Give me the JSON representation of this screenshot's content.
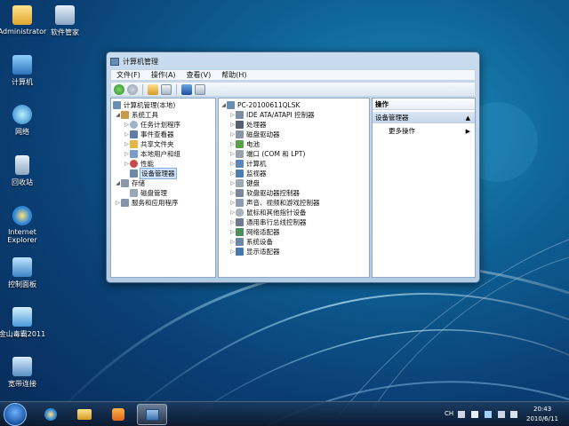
{
  "desktop": {
    "icons": [
      {
        "label": "Administrator",
        "icon": "user-folder-icon"
      },
      {
        "label": "软件管家",
        "icon": "software-manager-icon"
      },
      {
        "label": "计算机",
        "icon": "computer-icon"
      },
      {
        "label": "网络",
        "icon": "network-icon"
      },
      {
        "label": "回收站",
        "icon": "recycle-bin-icon"
      },
      {
        "label": "Internet Explorer",
        "icon": "internet-explorer-icon"
      },
      {
        "label": "控制面板",
        "icon": "control-panel-icon"
      },
      {
        "label": "金山毒霸2011",
        "icon": "antivirus-icon"
      },
      {
        "label": "宽带连接",
        "icon": "broadband-icon"
      }
    ]
  },
  "window": {
    "title": "计算机管理",
    "menu": [
      "文件(F)",
      "操作(A)",
      "查看(V)",
      "帮助(H)"
    ],
    "toolbar": [
      "back-icon",
      "forward-icon",
      "up-icon",
      "show-tree-icon",
      "help-icon",
      "properties-icon"
    ],
    "left_tree": [
      {
        "label": "计算机管理(本地)",
        "level": 0,
        "arrow": ""
      },
      {
        "label": "系统工具",
        "level": 1,
        "arrow": "◢"
      },
      {
        "label": "任务计划程序",
        "level": 2,
        "arrow": "▷"
      },
      {
        "label": "事件查看器",
        "level": 2,
        "arrow": "▷"
      },
      {
        "label": "共享文件夹",
        "level": 2,
        "arrow": "▷"
      },
      {
        "label": "本地用户和组",
        "level": 2,
        "arrow": "▷"
      },
      {
        "label": "性能",
        "level": 2,
        "arrow": "▷"
      },
      {
        "label": "设备管理器",
        "level": 2,
        "arrow": "",
        "selected": true
      },
      {
        "label": "存储",
        "level": 1,
        "arrow": "◢"
      },
      {
        "label": "磁盘管理",
        "level": 2,
        "arrow": ""
      },
      {
        "label": "服务和应用程序",
        "level": 1,
        "arrow": "▷"
      }
    ],
    "device_tree": [
      {
        "label": "PC-20100611QLSK",
        "level": 0,
        "arrow": "◢"
      },
      {
        "label": "IDE ATA/ATAPI 控制器",
        "level": 1,
        "arrow": "▷"
      },
      {
        "label": "处理器",
        "level": 1,
        "arrow": "▷"
      },
      {
        "label": "磁盘驱动器",
        "level": 1,
        "arrow": "▷"
      },
      {
        "label": "电池",
        "level": 1,
        "arrow": "▷"
      },
      {
        "label": "端口 (COM 和 LPT)",
        "level": 1,
        "arrow": "▷"
      },
      {
        "label": "计算机",
        "level": 1,
        "arrow": "▷"
      },
      {
        "label": "监视器",
        "level": 1,
        "arrow": "▷"
      },
      {
        "label": "键盘",
        "level": 1,
        "arrow": "▷"
      },
      {
        "label": "软盘驱动器控制器",
        "level": 1,
        "arrow": "▷"
      },
      {
        "label": "声音、视频和游戏控制器",
        "level": 1,
        "arrow": "▷"
      },
      {
        "label": "鼠标和其他指针设备",
        "level": 1,
        "arrow": "▷"
      },
      {
        "label": "通用串行总线控制器",
        "level": 1,
        "arrow": "▷"
      },
      {
        "label": "网络适配器",
        "level": 1,
        "arrow": "▷"
      },
      {
        "label": "系统设备",
        "level": 1,
        "arrow": "▷"
      },
      {
        "label": "显示适配器",
        "level": 1,
        "arrow": "▷"
      }
    ],
    "actions": {
      "header": "操作",
      "section": "设备管理器",
      "more": "更多操作"
    }
  },
  "taskbar": {
    "items": [
      "start-orb-icon",
      "internet-explorer-icon",
      "explorer-folder-icon",
      "media-player-icon",
      "computer-management-icon"
    ],
    "lang": "CH",
    "time": "20:43",
    "date": "2010/6/11"
  }
}
